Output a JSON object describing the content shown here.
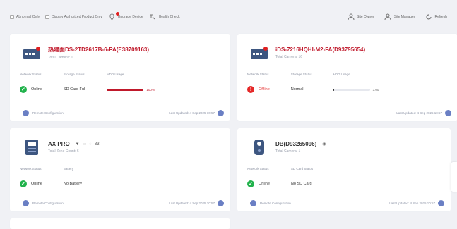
{
  "toolbar": {
    "checkbox1_label": "Abnormal Only",
    "checkbox2_label": "Display Authorized Product Only",
    "upgrade_label": "Upgrade Device",
    "health_label": "Health Check",
    "site_owner_label": "Site Owner",
    "site_manager_label": "Site Manager",
    "refresh_label": "Refresh"
  },
  "cards": [
    {
      "title": "热建面DS-2TD2617B-6-PA(E38709163)",
      "subtitle": "Total Camera: 1",
      "network_label": "Network Status",
      "network_value": "Online",
      "storage_label": "Storage Status",
      "storage_value": "SD Card Full",
      "hdd_label": "HDD Usage",
      "hdd_percent": 100,
      "hdd_text": "100%",
      "config_label": "Remote Configuration",
      "updated_text": "Last Updated: 4 Sep 2025 10:57"
    },
    {
      "title": "iDS-7216HQHI-M2-FA(D93795654)",
      "subtitle": "Total Camera: 16",
      "network_label": "Network Status",
      "network_value": "Offline",
      "storage_label": "Storage Status",
      "storage_value": "Normal",
      "hdd_label": "HDD Usage",
      "hdd_percent": 3,
      "hdd_text": "3.00",
      "config_label": "Remote Configuration",
      "updated_text": "Last Updated: 4 Sep 2025 10:57"
    },
    {
      "title": "AX PRO",
      "tag3": "33",
      "subtitle": "Total Zone Count: 6",
      "network_label": "Network Status",
      "network_value": "Online",
      "battery_label": "Battery",
      "battery_value": "No Battery",
      "config_label": "Remote Configuration",
      "updated_text": "Last Updated: 4 Sep 2025 10:57"
    },
    {
      "title": "DB(D93265096)",
      "subtitle": "Total Camera: 1",
      "network_label": "Network Status",
      "network_value": "Online",
      "sd_label": "SD Card Status",
      "sd_value": "No SD Card",
      "config_label": "Remote Configuration",
      "updated_text": "Last Updated: 4 Sep 2025 10:57"
    }
  ],
  "colors": {
    "accent": "#c0192b",
    "online": "#22b24c",
    "offline": "#e52828",
    "config": "#6a7fc4"
  }
}
